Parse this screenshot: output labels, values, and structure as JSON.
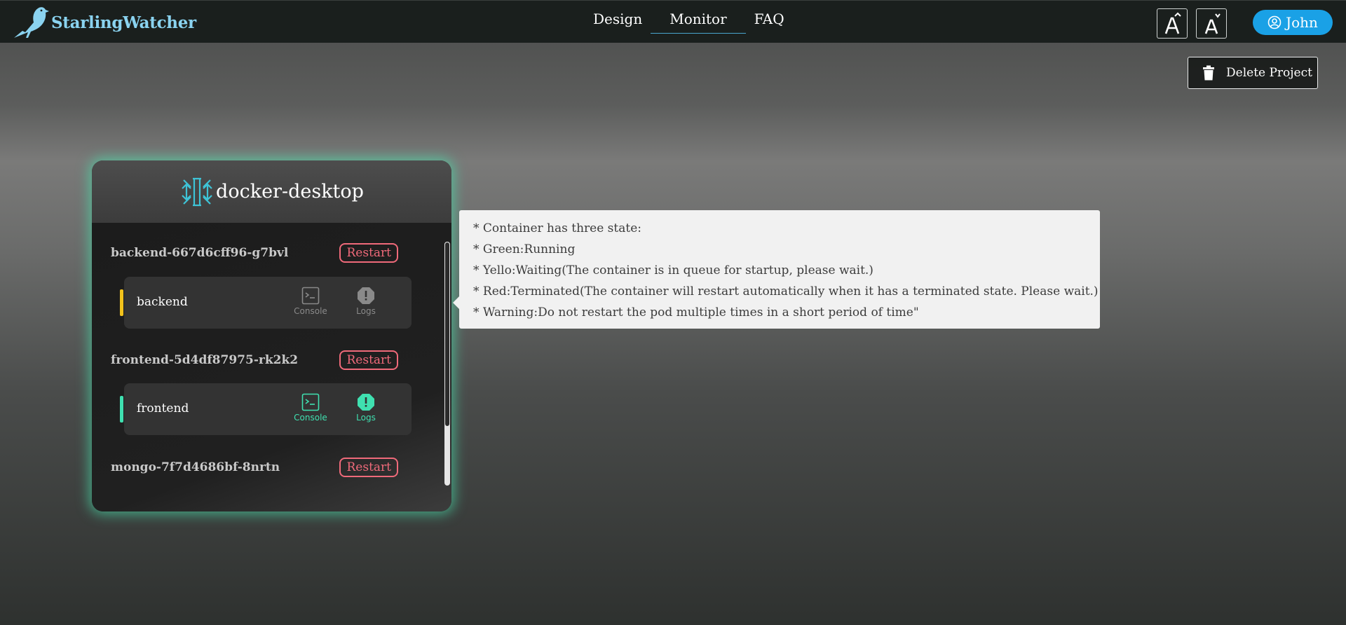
{
  "app": {
    "brand": "StarlingWatcher"
  },
  "nav": {
    "items": [
      {
        "label": "Design"
      },
      {
        "label": "Monitor"
      },
      {
        "label": "FAQ"
      }
    ],
    "active": "Monitor"
  },
  "header": {
    "user_label": "John"
  },
  "toolbar": {
    "delete_label": "Delete Project"
  },
  "node": {
    "title": "docker-desktop",
    "pods": [
      {
        "name": "backend-667d6cff96-g7bvl",
        "restart_label": "Restart",
        "container": {
          "name": "backend",
          "state": "waiting",
          "console_label": "Console",
          "logs_label": "Logs"
        }
      },
      {
        "name": "frontend-5d4df87975-rk2k2",
        "restart_label": "Restart",
        "container": {
          "name": "frontend",
          "state": "running",
          "console_label": "Console",
          "logs_label": "Logs"
        }
      },
      {
        "name": "mongo-7f7d4686bf-8nrtn",
        "restart_label": "Restart"
      }
    ]
  },
  "tooltip": {
    "lines": [
      "* Container has three state:",
      "* Green:Running",
      "* Yello:Waiting(The container is in queue for startup, please wait.)",
      "* Red:Terminated(The container will restart automatically when it has a terminated state. Please wait.)",
      "* Warning:Do not restart the pod multiple times in a short period of time\""
    ]
  },
  "colors": {
    "brand": "#8ad3f0",
    "accent": "#1aa1e6",
    "glow": "#48deaa",
    "running": "#3fe0b0",
    "waiting": "#f2c21b",
    "restart": "#f06a7a"
  },
  "icons": {
    "logo": "starling-bird-icon",
    "font_increase": "font-size-increase-icon",
    "font_decrease": "font-size-decrease-icon",
    "user": "user-circle-icon",
    "delete": "trash-icon",
    "node": "kubernetes-node-icon",
    "console": "terminal-icon",
    "logs": "alert-octagon-icon"
  }
}
